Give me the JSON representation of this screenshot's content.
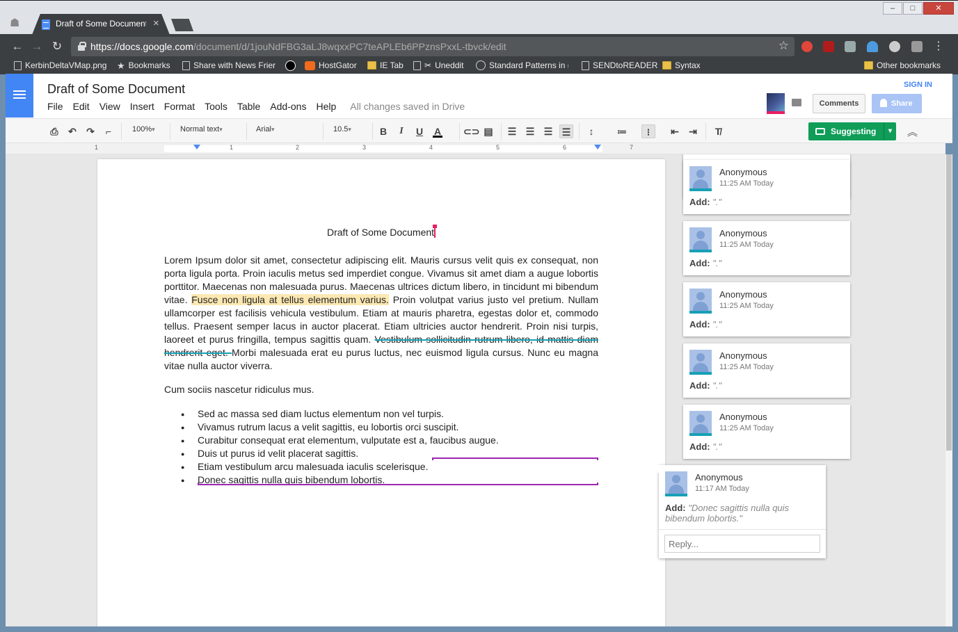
{
  "browser": {
    "tab_title": "Draft of Some Document",
    "url_host": "https://docs.google.com",
    "url_path": "/document/d/1jouNdFBG3aLJ8wqxxPC7teAPLEb6PPznsPxxL-tbvck/edit",
    "bookmarks": [
      {
        "label": "KerbinDeltaVMap.png",
        "icon": "page-icon"
      },
      {
        "label": "Bookmarks",
        "icon": "star-icon"
      },
      {
        "label": "Share with News Frier",
        "icon": "page-icon"
      },
      {
        "label": "",
        "icon": "skull-icon"
      },
      {
        "label": "HostGator",
        "icon": "hostgator-icon"
      },
      {
        "label": "IE Tab",
        "icon": "folder-icon"
      },
      {
        "label": "Uneddit",
        "icon": "scissors-icon"
      },
      {
        "label": "Standard Patterns in (",
        "icon": "wordpress-icon"
      },
      {
        "label": "SENDtoREADER",
        "icon": "page-icon"
      },
      {
        "label": "Syntax",
        "icon": "folder-icon"
      }
    ],
    "other_bookmarks": "Other bookmarks"
  },
  "docs": {
    "title": "Draft of Some Document",
    "menus": [
      "File",
      "Edit",
      "View",
      "Insert",
      "Format",
      "Tools",
      "Table",
      "Add-ons",
      "Help"
    ],
    "save_status": "All changes saved in Drive",
    "comments_label": "Comments",
    "share_label": "Share",
    "sign_in_label": "SIGN IN"
  },
  "toolbar": {
    "zoom": "100%",
    "style": "Normal text",
    "font": "Arial",
    "size": "10.5",
    "mode": "Suggesting"
  },
  "ruler": {
    "numbers": [
      "1",
      "1",
      "2",
      "3",
      "4",
      "5",
      "6",
      "7"
    ]
  },
  "document": {
    "heading": "Draft of Some Document",
    "para1_a": "Lorem Ipsum dolor sit amet, consectetur adipiscing elit. Mauris cursus velit quis ex consequat, non porta ligula porta. Proin iaculis metus sed imperdiet congue. Vivamus sit amet diam a augue lobortis porttitor. Maecenas non malesuada purus. Maecenas ultrices dictum libero, in tincidunt mi bibendum vitae. ",
    "para1_highlight": "Fusce non ligula at tellus elementum varius.",
    "para1_b": " Proin volutpat varius justo vel pretium. Nullam ullamcorper est facilisis vehicula vestibulum. Etiam at mauris pharetra, egestas dolor et, commodo tellus. Praesent semper lacus in auctor placerat. Etiam ultricies auctor hendrerit. Proin nisi turpis, laoreet et purus fringilla, tempus sagittis quam. ",
    "para1_struck": "Vestibulum sollicitudin rutrum libero, id mattis diam hendrerit eget. ",
    "para1_c": "Morbi malesuada erat eu purus luctus, nec euismod ligula cursus. Nunc eu magna vitae nulla auctor viverra.",
    "para2": "Cum sociis nascetur ridiculus mus.",
    "bullets": [
      "Sed ac massa sed diam luctus elementum non vel turpis.",
      "Vivamus rutrum lacus a velit sagittis, eu lobortis orci suscipit.",
      "Curabitur consequat erat elementum, vulputate est a, faucibus augue.",
      "Duis ut purus id velit placerat sagittis.",
      "Etiam vestibulum arcu malesuada iaculis scelerisque.",
      "Donec sagittis nulla quis bibendum lobortis."
    ]
  },
  "comments": [
    {
      "author": "Anonymous",
      "time": "11:25 AM Today",
      "action": "Add:",
      "text": "\".\""
    },
    {
      "author": "Anonymous",
      "time": "11:25 AM Today",
      "action": "Add:",
      "text": "\".\""
    },
    {
      "author": "Anonymous",
      "time": "11:25 AM Today",
      "action": "Add:",
      "text": "\".\""
    },
    {
      "author": "Anonymous",
      "time": "11:25 AM Today",
      "action": "Add:",
      "text": "\".\""
    },
    {
      "author": "Anonymous",
      "time": "11:25 AM Today",
      "action": "Add:",
      "text": "\".\""
    }
  ],
  "active_comment": {
    "author": "Anonymous",
    "time": "11:17 AM Today",
    "action": "Add:",
    "text": "\"Donec sagittis nulla quis bibendum lobortis.\"",
    "reply_placeholder": "Reply..."
  },
  "colors": {
    "docs_blue": "#4285f4",
    "suggest_green": "#0f9d58",
    "suggestion_purple": "#9c27b0",
    "highlight": "#fce8b2",
    "cursor": "#e91e63"
  }
}
